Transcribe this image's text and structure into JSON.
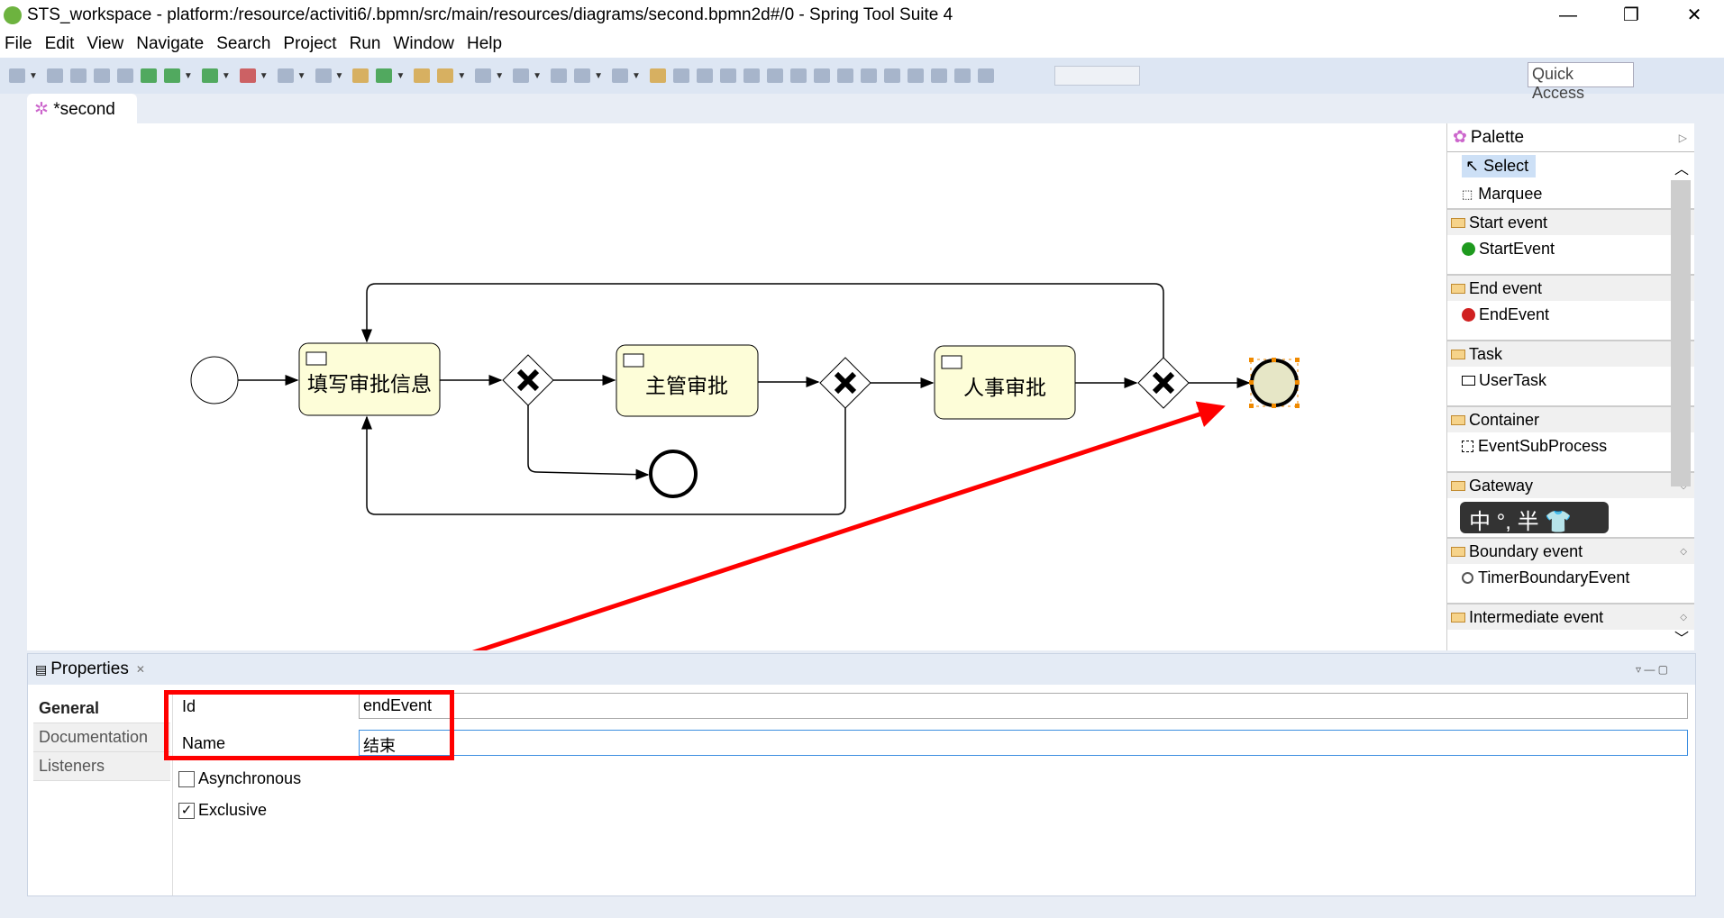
{
  "window": {
    "title": "STS_workspace - platform:/resource/activiti6/.bpmn/src/main/resources/diagrams/second.bpmn2d#/0 - Spring Tool Suite 4",
    "controls": [
      "minimize",
      "restore",
      "close"
    ]
  },
  "menu": [
    "File",
    "Edit",
    "View",
    "Navigate",
    "Search",
    "Project",
    "Run",
    "Window",
    "Help"
  ],
  "toolbar": {
    "quick_access": "Quick Access"
  },
  "editor": {
    "tab": "*second"
  },
  "diagram": {
    "tasks": [
      "填写审批信息",
      "主管审批",
      "人事审批"
    ],
    "selected": "endEvent"
  },
  "palette": {
    "title": "Palette",
    "tools": [
      "Select",
      "Marquee"
    ],
    "drawers": [
      {
        "label": "Start event",
        "items": [
          "StartEvent"
        ]
      },
      {
        "label": "End event",
        "items": [
          "EndEvent"
        ]
      },
      {
        "label": "Task",
        "items": [
          "UserTask"
        ]
      },
      {
        "label": "Container",
        "items": [
          "EventSubProcess"
        ]
      },
      {
        "label": "Gateway",
        "items": []
      },
      {
        "label": "Boundary event",
        "items": [
          "TimerBoundaryEvent"
        ]
      },
      {
        "label": "Intermediate event",
        "items": []
      }
    ]
  },
  "ime": {
    "text": "中 °, 半"
  },
  "properties": {
    "title": "Properties",
    "tabs": [
      "General",
      "Documentation",
      "Listeners"
    ],
    "id_label": "Id",
    "id_value": "endEvent",
    "name_label": "Name",
    "name_value": "结束",
    "asynchronous": {
      "label": "Asynchronous",
      "checked": false
    },
    "exclusive": {
      "label": "Exclusive",
      "checked": true
    }
  },
  "colors": {
    "annotation": "#ff0000",
    "task_fill": "#fdfdd8",
    "selection": "#f08a00"
  }
}
